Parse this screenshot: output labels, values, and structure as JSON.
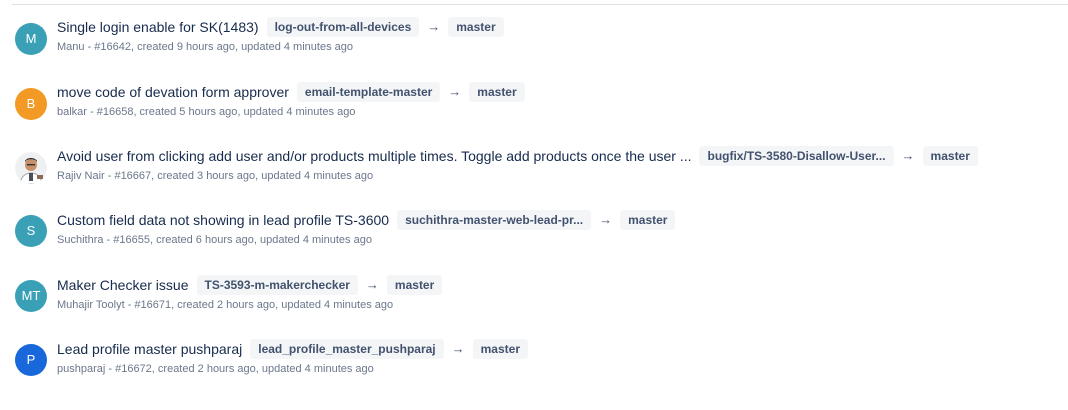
{
  "pull_requests": [
    {
      "avatar_initials": "M",
      "avatar_color": "#3aa0b6",
      "title": "Single login enable for SK(1483)",
      "source_branch": "log-out-from-all-devices",
      "target_branch": "master",
      "meta": "Manu - #16642, created 9 hours ago, updated 4 minutes ago"
    },
    {
      "avatar_initials": "B",
      "avatar_color": "#f29a25",
      "title": "move code of devation form approver",
      "source_branch": "email-template-master",
      "target_branch": "master",
      "meta": "balkar - #16658, created 5 hours ago, updated 4 minutes ago"
    },
    {
      "avatar_initials": "",
      "avatar_color": "#ffffff",
      "title": "Avoid user from clicking add user and/or products multiple times. Toggle add products once the user ...",
      "source_branch": "bugfix/TS-3580-Disallow-User...",
      "target_branch": "master",
      "meta": "Rajiv Nair - #16667, created 3 hours ago, updated 4 minutes ago"
    },
    {
      "avatar_initials": "S",
      "avatar_color": "#3aa0b6",
      "title": "Custom field data not showing in lead profile TS-3600",
      "source_branch": "suchithra-master-web-lead-pr...",
      "target_branch": "master",
      "meta": "Suchithra - #16655, created 6 hours ago, updated 4 minutes ago"
    },
    {
      "avatar_initials": "MT",
      "avatar_color": "#3aa0b6",
      "title": "Maker Checker issue",
      "source_branch": "TS-3593-m-makerchecker",
      "target_branch": "master",
      "meta": "Muhajir Toolyt - #16671, created 2 hours ago, updated 4 minutes ago"
    },
    {
      "avatar_initials": "P",
      "avatar_color": "#1868db",
      "title": "Lead profile master pushparaj",
      "source_branch": "lead_profile_master_pushparaj",
      "target_branch": "master",
      "meta": "pushparaj - #16672, created 2 hours ago, updated 4 minutes ago"
    }
  ],
  "arrow_glyph": "→"
}
